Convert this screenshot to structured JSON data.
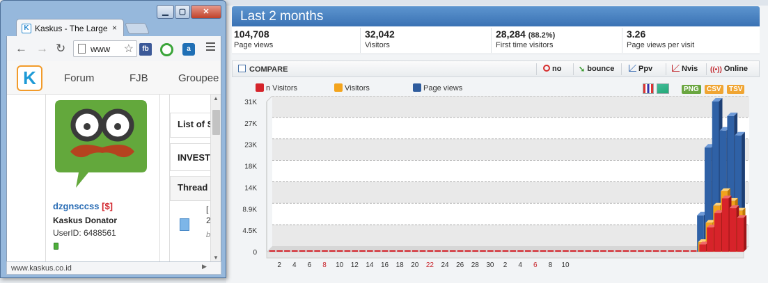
{
  "browser": {
    "tab_title": "Kaskus - The Largest",
    "tab_close": "×",
    "window_controls": [
      "▁",
      "▢",
      "✕"
    ],
    "url": "www",
    "ext_fb": "fb",
    "ext_a": "a",
    "site_nav": [
      "Forum",
      "FJB",
      "Groupee"
    ],
    "logo_letter": "K",
    "profile": {
      "username": "dzgnsccss",
      "tag": "[$]",
      "rank": "Kaskus Donator",
      "user_id": "UserID: 6488561"
    },
    "right_boxes": [
      "List of S",
      "INVEST",
      "Thread"
    ],
    "thread_snippet": [
      "[",
      "2",
      "b"
    ],
    "status_url": "www.kaskus.co.id",
    "scroll_up": "▲",
    "scroll_down": "▼",
    "hscroll_left": "◀",
    "hscroll_right": "▶"
  },
  "stats": {
    "title": "Last 2 months",
    "kpis": [
      {
        "value": "104,708",
        "pct": "",
        "label": "Page views"
      },
      {
        "value": "32,042",
        "pct": "",
        "label": "Visitors"
      },
      {
        "value": "28,284",
        "pct": "(88.2%)",
        "label": "First time visitors"
      },
      {
        "value": "3.26",
        "pct": "",
        "label": "Page views per visit"
      }
    ],
    "compare_label": "COMPARE",
    "toolbar": [
      "no",
      "bounce",
      "Ppv",
      "Nvis",
      "Online"
    ],
    "legend": [
      {
        "label": "n Visitors",
        "color": "#d5242b"
      },
      {
        "label": "Visitors",
        "color": "#f3a41d"
      },
      {
        "label": "Page views",
        "color": "#2f5c9d"
      }
    ],
    "exports": [
      {
        "label": "PNG",
        "color": "#6aa640"
      },
      {
        "label": "CSV",
        "color": "#f0a533"
      },
      {
        "label": "TSV",
        "color": "#f0a533"
      }
    ]
  },
  "chart_data": {
    "type": "bar",
    "y_ticks": [
      "31K",
      "27K",
      "23K",
      "18K",
      "14K",
      "8.9K",
      "4.5K",
      "0"
    ],
    "ylim": [
      0,
      31000
    ],
    "x_tick_labels": [
      "2",
      "4",
      "6",
      "8",
      "10",
      "12",
      "14",
      "16",
      "18",
      "20",
      "22",
      "24",
      "26",
      "28",
      "30",
      "2",
      "4",
      "6",
      "8",
      "10"
    ],
    "x_tick_highlight": [
      false,
      false,
      false,
      true,
      false,
      false,
      false,
      false,
      false,
      false,
      true,
      false,
      false,
      false,
      false,
      false,
      false,
      true,
      false,
      false
    ],
    "leading_empty_days": 57,
    "series": [
      {
        "name": "n Visitors",
        "values": [
          1500,
          5000,
          8000,
          11000,
          9000,
          7000
        ]
      },
      {
        "name": "Visitors",
        "values": [
          2000,
          6000,
          9500,
          12500,
          10500,
          8500
        ]
      },
      {
        "name": "Page views",
        "values": [
          7500,
          21500,
          31000,
          25000,
          28000,
          24000
        ]
      }
    ],
    "grid": true
  }
}
